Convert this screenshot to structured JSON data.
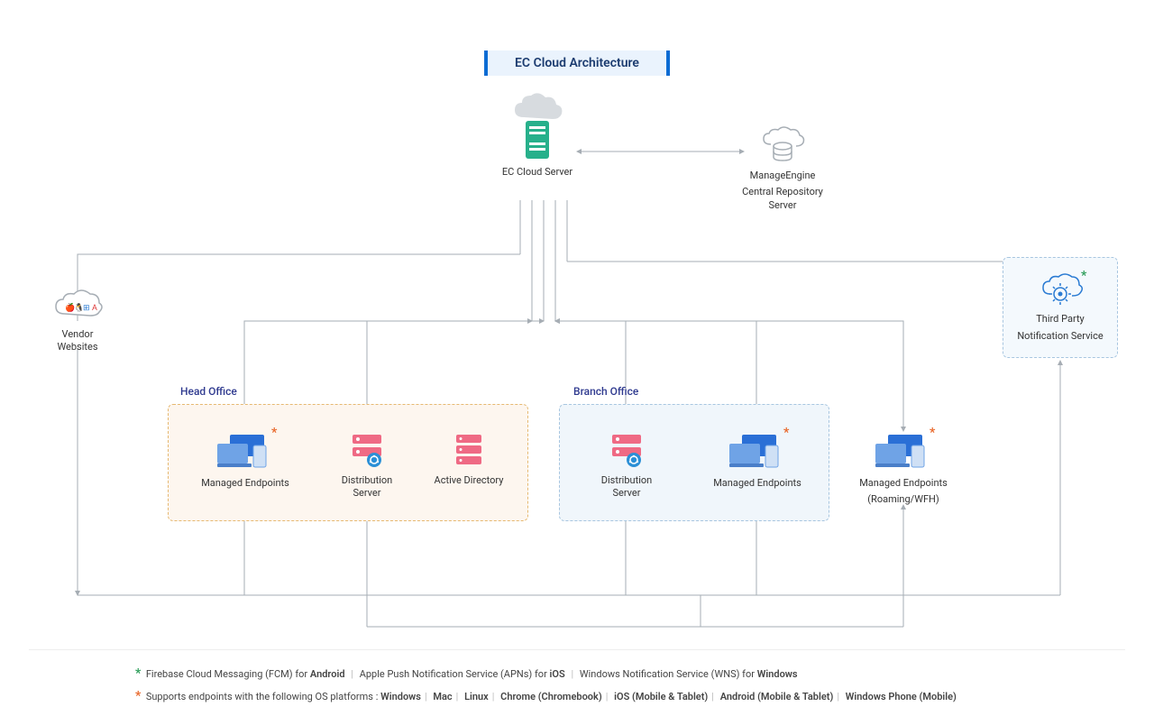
{
  "title": "EC Cloud Architecture",
  "nodes": {
    "cloud_server": "EC Cloud Server",
    "repo_server_line1": "ManageEngine",
    "repo_server_line2": "Central Repository Server",
    "vendor": "Vendor Websites",
    "thirdparty_line1": "Third Party",
    "thirdparty_line2": "Notification Service",
    "head_office": "Head Office",
    "branch_office": "Branch Office",
    "managed_endpoints": "Managed Endpoints",
    "dist_server": "Distribution Server",
    "active_dir": "Active Directory",
    "roaming_line1": "Managed Endpoints",
    "roaming_line2": "(Roaming/WFH)"
  },
  "legend": {
    "green_prefix": "Firebase Cloud Messaging (FCM) for",
    "green_b1": "Android",
    "green_mid1": "Apple Push Notification Service (APNs) for",
    "green_b2": "iOS",
    "green_mid2": "Windows Notification Service (WNS) for",
    "green_b3": "Windows",
    "orange_prefix": "Supports endpoints with the following OS platforms :",
    "orange_platforms": [
      "Windows",
      "Mac",
      "Linux",
      "Chrome (Chromebook)",
      "iOS (Mobile & Tablet)",
      "Android (Mobile & Tablet)",
      "Windows Phone (Mobile)"
    ]
  }
}
